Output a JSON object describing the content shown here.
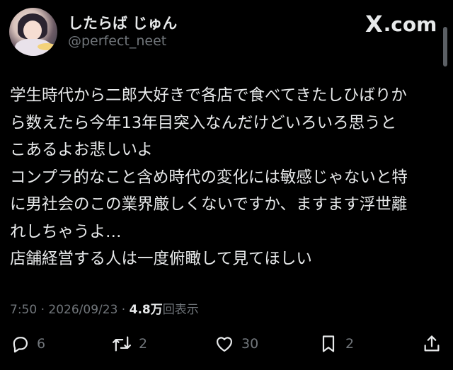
{
  "author": {
    "display_name": "したらば じゅん",
    "handle": "@perfect_neet"
  },
  "brand": {
    "logo_text": ".com",
    "logo_mark": "X"
  },
  "tweet": {
    "lines": [
      "学生時代から二郎大好きで各店で食べてきたしひばりか",
      "ら数えたら今年13年目突入なんだけどいろいろ思うと",
      "こあるよお悲しいよ",
      "コンプラ的なこと含め時代の変化には敏感じゃないと特",
      "に男社会のこの業界厳しくないですか、ますます浮世離",
      "れしちゃうよ…",
      "店舗経営する人は一度俯瞰して見てほしい"
    ],
    "time": "7:50",
    "separator": " · ",
    "date": "2026/09/23",
    "views_count": "4.8万",
    "views_label": "回表示"
  },
  "actions": {
    "reply_count": "6",
    "retweet_count": "2",
    "like_count": "30",
    "bookmark_count": "2"
  },
  "colors": {
    "background": "#000000",
    "text": "#e7e9ea",
    "muted": "#71767b"
  }
}
